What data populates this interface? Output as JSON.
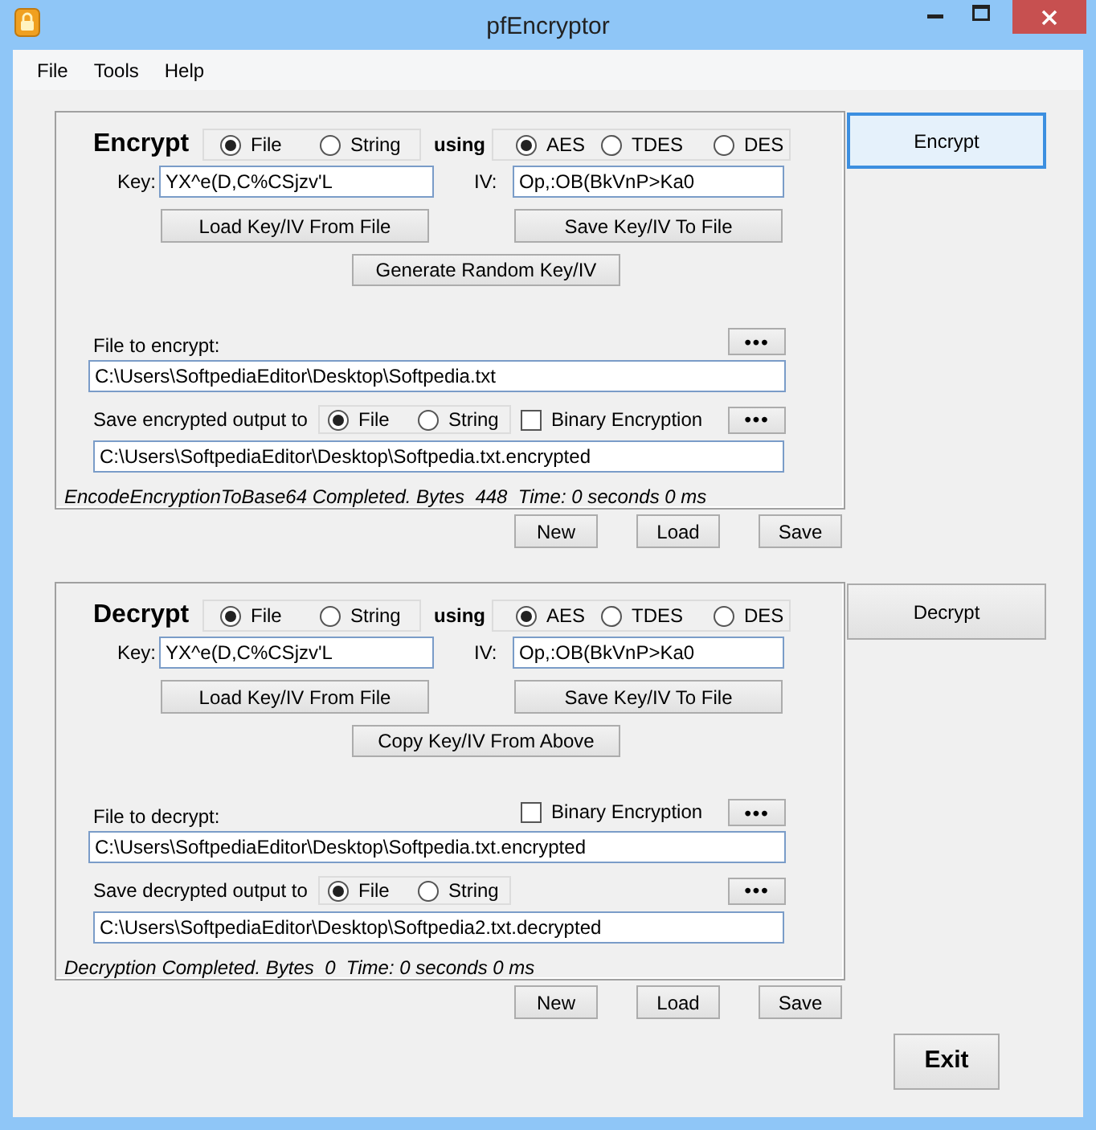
{
  "window": {
    "title": "pfEncryptor"
  },
  "menu": [
    {
      "label": "File"
    },
    {
      "label": "Tools"
    },
    {
      "label": "Help"
    }
  ],
  "panels": [
    {
      "kind": "encrypt",
      "heading": "Encrypt",
      "source_options": [
        {
          "label": "File",
          "selected": true
        },
        {
          "label": "String",
          "selected": false
        }
      ],
      "using": "using",
      "algorithms": [
        {
          "label": "AES",
          "selected": true
        },
        {
          "label": "TDES",
          "selected": false
        },
        {
          "label": "DES",
          "selected": false
        }
      ],
      "key_label": "Key:",
      "key": "YX^e(D,C%CSjzv'L",
      "iv_label": "IV:",
      "iv": "Op,:OB(BkVnP>Ka0",
      "key_buttons": [
        "Load Key/IV From File",
        "Save Key/IV To File"
      ],
      "extra_button": "Generate Random Key/IV",
      "file_label": "File to encrypt:",
      "file_browse": "•••",
      "file_path": "C:\\Users\\SoftpediaEditor\\Desktop\\Softpedia.txt",
      "output_label": "Save encrypted output to",
      "output_options": [
        {
          "label": "File",
          "selected": true
        },
        {
          "label": "String",
          "selected": false
        }
      ],
      "binary": {
        "label": "Binary Encryption",
        "checked": false
      },
      "output_browse": "•••",
      "output_path": "C:\\Users\\SoftpediaEditor\\Desktop\\Softpedia.txt.encrypted",
      "status": "EncodeEncryptionToBase64 Completed. Bytes  448  Time: 0 seconds 0 ms",
      "action": {
        "label": "Encrypt",
        "focused": true
      },
      "file_buttons": [
        "New",
        "Load",
        "Save"
      ]
    },
    {
      "kind": "decrypt",
      "heading": "Decrypt",
      "source_options": [
        {
          "label": "File",
          "selected": true
        },
        {
          "label": "String",
          "selected": false
        }
      ],
      "using": "using",
      "algorithms": [
        {
          "label": "AES",
          "selected": true
        },
        {
          "label": "TDES",
          "selected": false
        },
        {
          "label": "DES",
          "selected": false
        }
      ],
      "key_label": "Key:",
      "key": "YX^e(D,C%CSjzv'L",
      "iv_label": "IV:",
      "iv": "Op,:OB(BkVnP>Ka0",
      "key_buttons": [
        "Load Key/IV From File",
        "Save Key/IV To File"
      ],
      "extra_button": "Copy Key/IV From Above",
      "file_label": "File to decrypt:",
      "file_browse": "•••",
      "file_path": "C:\\Users\\SoftpediaEditor\\Desktop\\Softpedia.txt.encrypted",
      "output_label": "Save decrypted output to",
      "output_options": [
        {
          "label": "File",
          "selected": true
        },
        {
          "label": "String",
          "selected": false
        }
      ],
      "binary": {
        "label": "Binary Encryption",
        "checked": false
      },
      "output_browse": "•••",
      "output_path": "C:\\Users\\SoftpediaEditor\\Desktop\\Softpedia2.txt.decrypted",
      "status": "Decryption Completed. Bytes  0  Time: 0 seconds 0 ms",
      "action": {
        "label": "Decrypt",
        "focused": false
      },
      "file_buttons": [
        "New",
        "Load",
        "Save"
      ]
    }
  ],
  "exit_button": "Exit"
}
